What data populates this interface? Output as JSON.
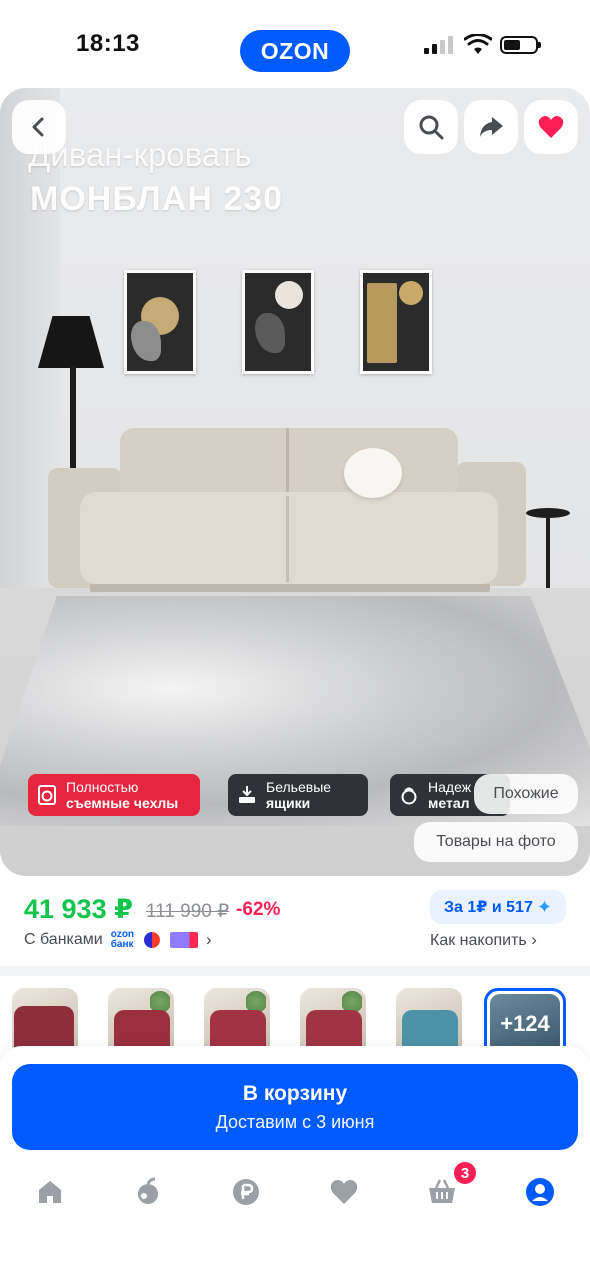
{
  "status_bar": {
    "time": "18:13",
    "logo": "OZON",
    "signal_bars": 2,
    "battery_level": 0.45
  },
  "product_photo": {
    "title_line1": "Диван-кровать",
    "title_line2": "МОНБЛАН 230",
    "buttons": {
      "back_icon": "chevron-left-icon",
      "search_icon": "search-icon",
      "share_icon": "share-icon",
      "favorite_icon": "heart-icon",
      "favorite_color": "#ff1f55"
    },
    "features": [
      {
        "line1": "Полностью",
        "line2": "съемные чехлы",
        "icon": "washing-machine-icon",
        "color": "#e6263f"
      },
      {
        "line1": "Бельевые",
        "line2": "ящики",
        "icon": "drawer-icon",
        "color": "#2f3237"
      },
      {
        "line1": "Надеж",
        "line2": "метал",
        "icon": "weight-icon",
        "color": "#2f3237"
      }
    ],
    "similar_label": "Похожие",
    "on_photo_label": "Товары на фото"
  },
  "pricing": {
    "price": "41 933 ₽",
    "old_price": "111 990 ₽",
    "discount": "-62%",
    "bonus": "За 1₽ и 517",
    "banks_label": "С банками",
    "ozon_bank_top": "ozon",
    "ozon_bank_bottom": "банк",
    "how_accumulate": "Как накопить",
    "price_color": "#10c44c",
    "discount_color": "#ff1f55"
  },
  "variants": {
    "items": [
      {
        "name": "variant-burgundy-1",
        "color": "#8e2e3c"
      },
      {
        "name": "variant-burgundy-2",
        "color": "#9a2f3e"
      },
      {
        "name": "variant-burgundy-3",
        "color": "#a23244"
      },
      {
        "name": "variant-burgundy-4",
        "color": "#a03444"
      },
      {
        "name": "variant-teal",
        "color": "#4d93a8"
      }
    ],
    "more_label": "+124"
  },
  "cart": {
    "button_label": "В корзину",
    "delivery": "Доставим с 3 июня",
    "color": "#005bff"
  },
  "tab_bar": {
    "items": [
      "home-icon",
      "fresh-icon",
      "ruble-icon",
      "heart-icon",
      "cart-icon",
      "profile-icon"
    ],
    "cart_badge": "3",
    "active": "profile-icon",
    "active_color": "#005bff"
  }
}
